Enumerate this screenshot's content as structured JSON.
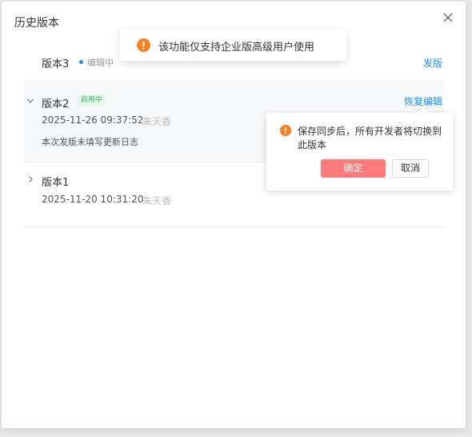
{
  "modal": {
    "title": "历史版本"
  },
  "versions": [
    {
      "name": "版本3",
      "status": "编辑中",
      "action": "发版"
    },
    {
      "name": "版本2",
      "badge": "启用中",
      "action": "恢复编辑",
      "time": "2025-11-26 09:37:52",
      "author": "朱天香",
      "log": "本次发版未填写更新日志"
    },
    {
      "name": "版本1",
      "time": "2025-11-20 10:31:20",
      "author": "朱天香"
    }
  ],
  "toast": {
    "message": "该功能仅支持企业版高级用户使用",
    "icon": "warning-icon",
    "color": "#f7811d"
  },
  "popconfirm": {
    "message": "保存同步后，所有开发者将切换到此版本",
    "confirm_label": "确定",
    "cancel_label": "取消",
    "confirm_color": "#ff7a7a"
  },
  "colors": {
    "link": "#1890ff",
    "active_badge": "#38b55b"
  }
}
